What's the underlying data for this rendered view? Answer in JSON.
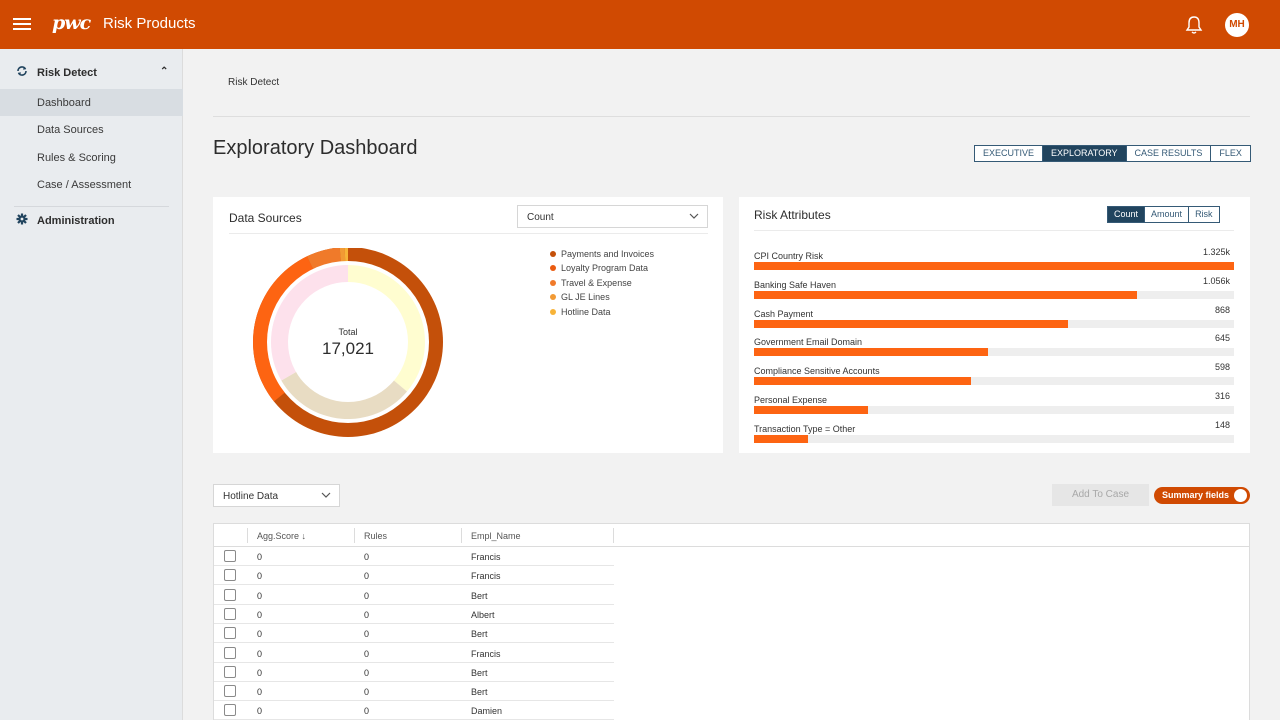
{
  "header": {
    "logo_text": "pwc",
    "product": "Risk Products",
    "user_initials": "MH"
  },
  "sidebar": {
    "section": "Risk Detect",
    "items": [
      {
        "label": "Dashboard",
        "active": true
      },
      {
        "label": "Data Sources"
      },
      {
        "label": "Rules & Scoring"
      },
      {
        "label": "Case / Assessment"
      }
    ],
    "admin": "Administration"
  },
  "breadcrumb": "Risk Detect",
  "page_title": "Exploratory Dashboard",
  "view_tabs": [
    "EXECUTIVE",
    "EXPLORATORY",
    "CASE RESULTS",
    "FLEX"
  ],
  "active_view": "EXPLORATORY",
  "data_sources": {
    "title": "Data Sources",
    "dropdown_value": "Count",
    "total_label": "Total",
    "total_value": "17,021",
    "legend": [
      {
        "label": "Payments and Invoices",
        "color": "#c4500a"
      },
      {
        "label": "Loyalty Program Data",
        "color": "#ea5b10"
      },
      {
        "label": "Travel & Expense",
        "color": "#f07a2a"
      },
      {
        "label": "GL JE Lines",
        "color": "#f29a34"
      },
      {
        "label": "Hotline Data",
        "color": "#f7b338"
      }
    ]
  },
  "risk_attributes": {
    "title": "Risk Attributes",
    "toggles": [
      "Count",
      "Amount",
      "Risk"
    ],
    "active_toggle": "Count",
    "bars": [
      {
        "label": "CPI Country Risk",
        "display": "1.325k",
        "value": 1325
      },
      {
        "label": "Banking Safe Haven",
        "display": "1.056k",
        "value": 1056
      },
      {
        "label": "Cash Payment",
        "display": "868",
        "value": 868
      },
      {
        "label": "Government Email Domain",
        "display": "645",
        "value": 645
      },
      {
        "label": "Compliance Sensitive Accounts",
        "display": "598",
        "value": 598
      },
      {
        "label": "Personal Expense",
        "display": "316",
        "value": 316
      },
      {
        "label": "Transaction Type = Other",
        "display": "148",
        "value": 148
      }
    ]
  },
  "table_controls": {
    "source_dropdown": "Hotline Data",
    "add_to_case": "Add To Case",
    "summary_toggle": "Summary fields"
  },
  "table": {
    "columns": [
      "Agg.Score ↓",
      "Rules",
      "Empl_Name"
    ],
    "rows": [
      [
        "0",
        "0",
        "Francis"
      ],
      [
        "0",
        "0",
        "Francis"
      ],
      [
        "0",
        "0",
        "Bert"
      ],
      [
        "0",
        "0",
        "Albert"
      ],
      [
        "0",
        "0",
        "Bert"
      ],
      [
        "0",
        "0",
        "Francis"
      ],
      [
        "0",
        "0",
        "Bert"
      ],
      [
        "0",
        "0",
        "Bert"
      ],
      [
        "0",
        "0",
        "Damien"
      ]
    ]
  }
}
